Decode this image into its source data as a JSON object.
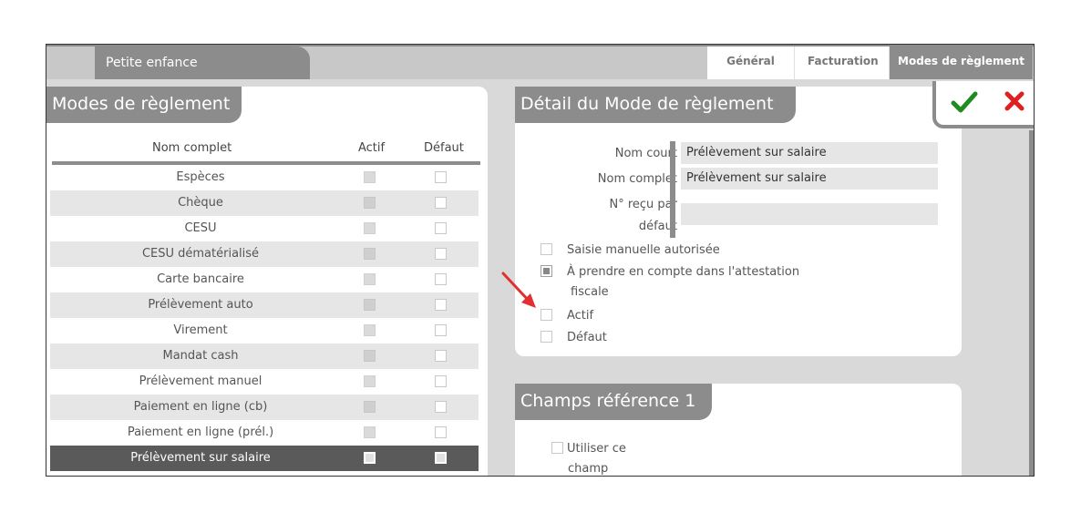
{
  "app_tab": "Petite enfance",
  "tabs": [
    {
      "label": "Général",
      "active": false
    },
    {
      "label": "Facturation",
      "active": false
    },
    {
      "label": "Modes de règlement",
      "active": true
    }
  ],
  "list": {
    "title": "Modes de règlement",
    "columns": {
      "name": "Nom complet",
      "actif": "Actif",
      "defaut": "Défaut"
    },
    "rows": [
      {
        "name": "Espèces"
      },
      {
        "name": "Chèque"
      },
      {
        "name": "CESU"
      },
      {
        "name": "CESU dématérialisé"
      },
      {
        "name": "Carte bancaire"
      },
      {
        "name": "Prélèvement auto"
      },
      {
        "name": "Virement"
      },
      {
        "name": "Mandat cash"
      },
      {
        "name": "Prélèvement manuel"
      },
      {
        "name": "Paiement en ligne (cb)"
      },
      {
        "name": "Paiement en ligne (prél.)"
      },
      {
        "name": "Prélèvement sur salaire",
        "selected": true
      }
    ]
  },
  "detail": {
    "title": "Détail du Mode de règlement",
    "nom_court_label": "Nom court",
    "nom_court_value": "Prélèvement sur salaire",
    "nom_complet_label": "Nom complet",
    "nom_complet_value": "Prélèvement sur salaire",
    "recu_label_1": "N° reçu par",
    "recu_label_2": "défaut",
    "recu_value": "",
    "options": {
      "saisie": "Saisie manuelle autorisée",
      "attestation_1": "À prendre en compte dans l'attestation",
      "attestation_2": "fiscale",
      "actif": "Actif",
      "defaut": "Défaut"
    }
  },
  "champs": {
    "title": "Champs référence 1",
    "utiliser_1": "Utiliser ce",
    "utiliser_2": "champ"
  },
  "colors": {
    "accent": "#8c8c8c",
    "confirm": "#1e8c1e",
    "cancel": "#e02020",
    "arrow": "#e03030"
  },
  "icons": {
    "confirm": "check-icon",
    "cancel": "close-icon"
  }
}
